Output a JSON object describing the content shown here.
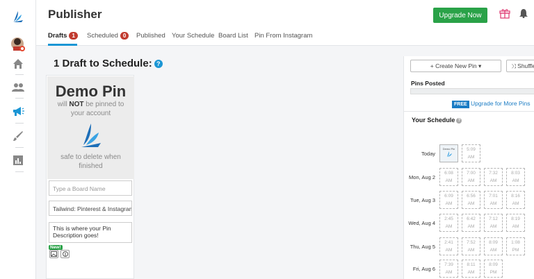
{
  "header": {
    "title": "Publisher",
    "upgrade_label": "Upgrade Now"
  },
  "tabs": [
    {
      "label": "Drafts",
      "badge": "1"
    },
    {
      "label": "Scheduled",
      "badge": "0"
    },
    {
      "label": "Published"
    },
    {
      "label": "Your Schedule"
    },
    {
      "label": "Board List"
    },
    {
      "label": "Pin From Instagram"
    }
  ],
  "main": {
    "heading": "1 Draft to Schedule:",
    "card": {
      "title": "Demo Pin",
      "note_pre": "will ",
      "note_strong": "NOT",
      "note_post": " be pinned to your account",
      "safe_note": "safe to delete when finished",
      "board_placeholder": "Type a Board Name",
      "source_value": "Tailwind: Pinterest & Instagram S",
      "description": "This is where your Pin Description goes!",
      "new_badge": "New!"
    }
  },
  "panel": {
    "create_label": "+ Create New Pin ▾",
    "shuffle_label": "⤨ Shuffle",
    "pins_posted": "Pins Posted",
    "free_badge": "FREE",
    "upgrade_more": "Upgrade for More Pins",
    "schedule_title": "Your Schedule",
    "demo_thumb_label": "Demo Pin",
    "schedule": [
      {
        "day": "Today",
        "slots": [
          {
            "filled": true
          },
          {
            "time": "5:09",
            "ampm": "AM"
          }
        ]
      },
      {
        "day": "Mon, Aug 2",
        "slots": [
          {
            "time": "6:08",
            "ampm": "AM"
          },
          {
            "time": "7:00",
            "ampm": "AM"
          },
          {
            "time": "7:32",
            "ampm": "AM"
          },
          {
            "time": "8:03",
            "ampm": "AM"
          }
        ]
      },
      {
        "day": "Tue, Aug 3",
        "slots": [
          {
            "time": "6:09",
            "ampm": "AM"
          },
          {
            "time": "6:56",
            "ampm": "AM"
          },
          {
            "time": "7:01",
            "ampm": "AM"
          },
          {
            "time": "8:16",
            "ampm": "AM"
          }
        ]
      },
      {
        "day": "Wed, Aug 4",
        "slots": [
          {
            "time": "2:45",
            "ampm": "AM"
          },
          {
            "time": "6:42",
            "ampm": "AM"
          },
          {
            "time": "7:12",
            "ampm": "AM"
          },
          {
            "time": "8:19",
            "ampm": "AM"
          }
        ]
      },
      {
        "day": "Thu, Aug 5",
        "slots": [
          {
            "time": "2:41",
            "ampm": "AM"
          },
          {
            "time": "7:52",
            "ampm": "AM"
          },
          {
            "time": "8:09",
            "ampm": "AM"
          },
          {
            "time": "1:08",
            "ampm": "PM"
          }
        ]
      },
      {
        "day": "Fri, Aug 6",
        "slots": [
          {
            "time": "7:39",
            "ampm": "AM"
          },
          {
            "time": "8:11",
            "ampm": "AM"
          },
          {
            "time": "8:09",
            "ampm": "PM"
          }
        ]
      }
    ]
  },
  "colors": {
    "accent": "#1b96d5",
    "upgrade_green": "#2aa248",
    "badge_red": "#c13b2f",
    "link_blue": "#1b7cc4"
  }
}
